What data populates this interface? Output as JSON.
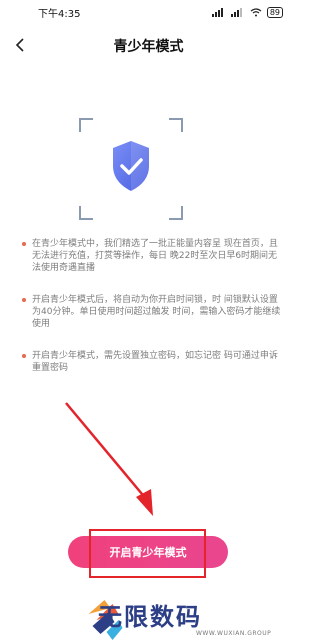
{
  "status_bar": {
    "time": "下午4:35",
    "battery": "89"
  },
  "header": {
    "title": "青少年模式"
  },
  "items": [
    {
      "text": "在青少年模式中，我们精选了一批正能量内容呈 现在首页，且无法进行充值，打赏等操作，每日 晚22时至次日早6时期间无法使用奇遇直播"
    },
    {
      "text": "开启青少年模式后，将自动为你开启时间锁，时 间锁默认设置为40分钟。单日使用时间超过触发 时间，需输入密码才能继续使用"
    },
    {
      "text": "开启青少年模式，需先设置独立密码，如忘记密 码可通过申诉重置密码"
    }
  ],
  "cta": {
    "label": "开启青少年模式"
  },
  "watermark": {
    "title": "无限数码",
    "url": "WWW.WUXIAN.GROUP"
  },
  "colors": {
    "accent": "#ee407f",
    "annotation": "#e3242b",
    "shield": "#5b74f0"
  }
}
